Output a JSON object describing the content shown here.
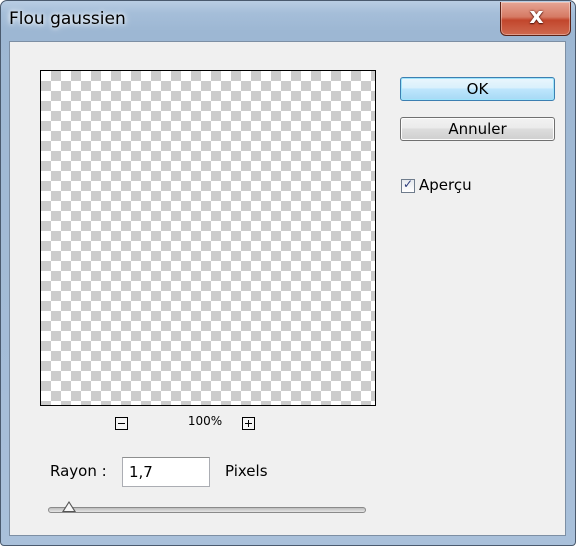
{
  "window": {
    "title": "Flou gaussien",
    "close_label": "x"
  },
  "preview": {
    "zoom_level": "100%",
    "zoom_out_icon": "minus-icon",
    "zoom_in_icon": "plus-icon"
  },
  "buttons": {
    "ok_label": "OK",
    "cancel_label": "Annuler"
  },
  "preview_option": {
    "label": "Aperçu",
    "checked": true
  },
  "radius": {
    "label": "Rayon :",
    "value": "1,7",
    "unit": "Pixels",
    "slider_fraction": 0.06
  },
  "colors": {
    "title_bar": "#a5bed9",
    "close_button": "#c2462c",
    "ok_button_border": "#3c7fb1",
    "dialog_background": "#f0f0f0"
  }
}
